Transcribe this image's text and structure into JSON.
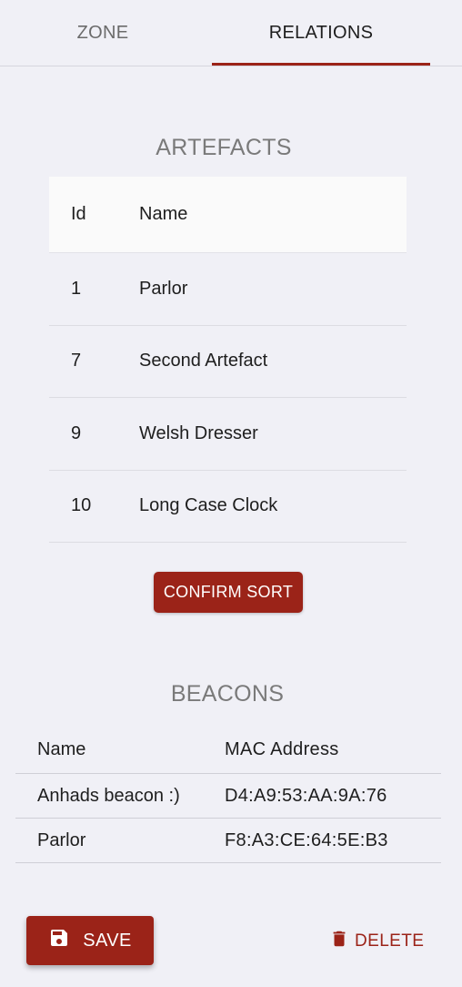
{
  "tabs": [
    {
      "label": "ZONE"
    },
    {
      "label": "RELATIONS"
    }
  ],
  "artefacts": {
    "title": "ARTEFACTS",
    "columns": [
      "Id",
      "Name"
    ],
    "rows": [
      {
        "id": "1",
        "name": "Parlor"
      },
      {
        "id": "7",
        "name": "Second Artefact"
      },
      {
        "id": "9",
        "name": "Welsh Dresser"
      },
      {
        "id": "10",
        "name": "Long Case Clock"
      }
    ],
    "confirm_label": "CONFIRM SORT"
  },
  "beacons": {
    "title": "BEACONS",
    "columns": [
      "Name",
      "MAC Address"
    ],
    "rows": [
      {
        "name": "Anhads beacon :)",
        "mac": "D4:A9:53:AA:9A:76"
      },
      {
        "name": "Parlor",
        "mac": "F8:A3:CE:64:5E:B3"
      }
    ]
  },
  "actions": {
    "save_label": "SAVE",
    "save_icon": "floppy-disk-icon",
    "delete_label": "DELETE",
    "delete_icon": "trash-icon"
  },
  "colors": {
    "accent": "#9b2318",
    "background": "#f0f0f6"
  }
}
